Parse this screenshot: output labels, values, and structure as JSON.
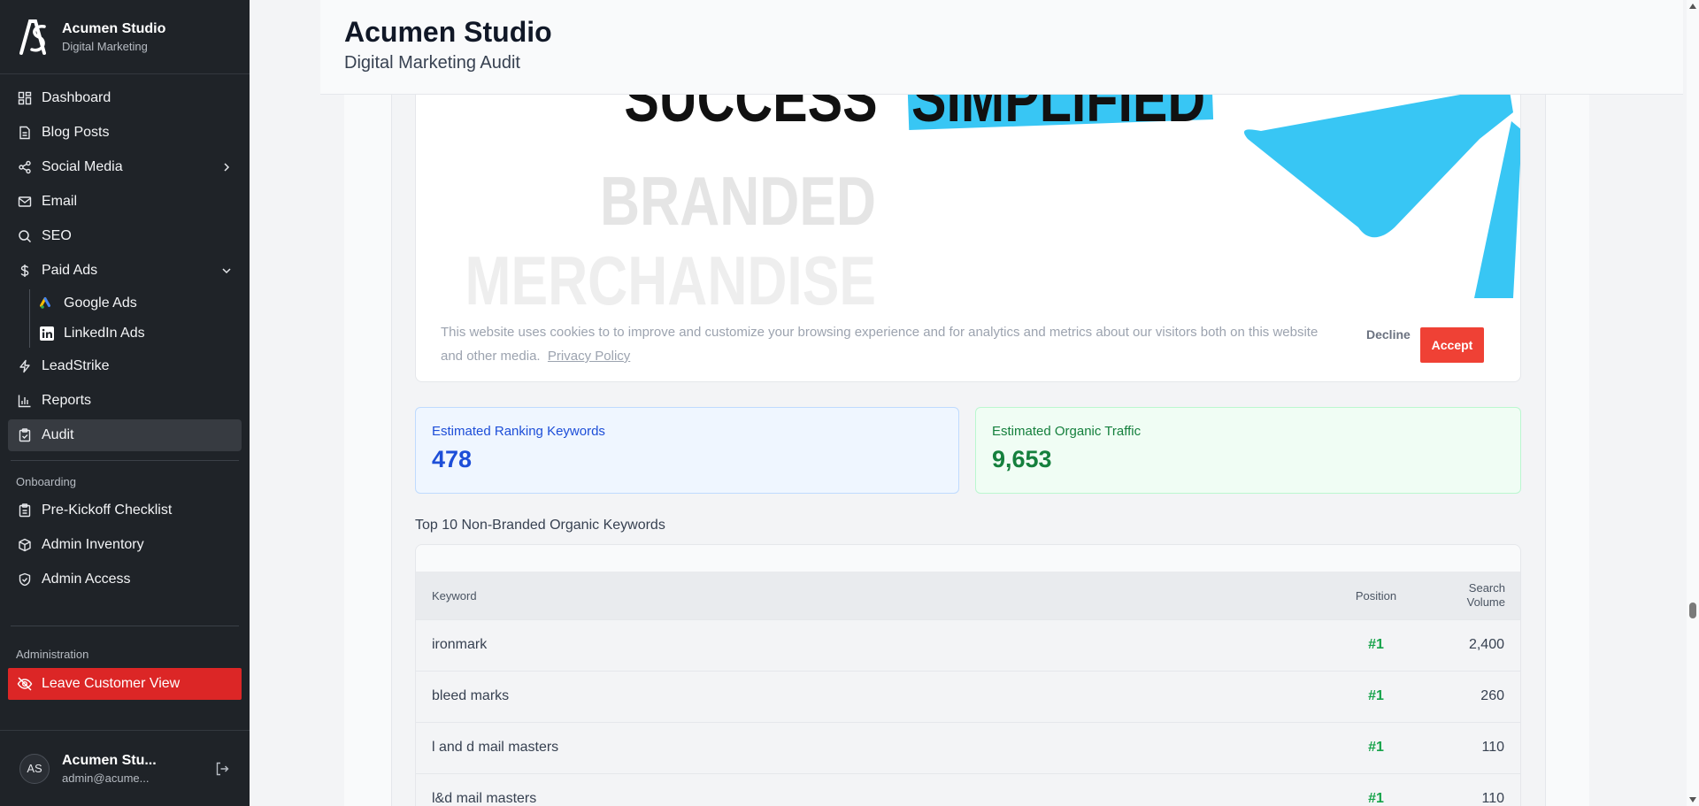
{
  "brand": {
    "title": "Acumen Studio",
    "subtitle": "Digital Marketing"
  },
  "nav": {
    "items": [
      {
        "label": "Dashboard",
        "icon": "dashboard-icon"
      },
      {
        "label": "Blog Posts",
        "icon": "document-icon"
      },
      {
        "label": "Social Media",
        "icon": "share-icon"
      },
      {
        "label": "Email",
        "icon": "mail-icon"
      },
      {
        "label": "SEO",
        "icon": "search-icon"
      },
      {
        "label": "Paid Ads",
        "icon": "dollar-icon"
      }
    ],
    "paid_ads_sub": [
      {
        "label": "Google Ads",
        "icon": "google-ads-icon"
      },
      {
        "label": "LinkedIn Ads",
        "icon": "linkedin-icon"
      }
    ],
    "items2": [
      {
        "label": "LeadStrike",
        "icon": "bolt-icon"
      },
      {
        "label": "Reports",
        "icon": "bar-chart-icon"
      },
      {
        "label": "Audit",
        "icon": "clipboard-check-icon"
      }
    ],
    "onboarding_label": "Onboarding",
    "onboarding": [
      {
        "label": "Pre-Kickoff Checklist",
        "icon": "clipboard-icon"
      },
      {
        "label": "Admin Inventory",
        "icon": "box-icon"
      },
      {
        "label": "Admin Access",
        "icon": "shield-check-icon"
      }
    ],
    "administration_label": "Administration",
    "leave_label": "Leave Customer View"
  },
  "user": {
    "initials": "AS",
    "name": "Acumen Stu...",
    "email": "admin@acume..."
  },
  "header": {
    "title": "Acumen Studio",
    "subtitle": "Digital Marketing Audit"
  },
  "banner": {
    "headline_left": "SUCCESS",
    "headline_right": "SIMPLIFIED",
    "line1": "BRANDED",
    "line2": "MERCHANDISE"
  },
  "cookie": {
    "text": "This website uses cookies to to improve and customize your browsing experience and for analytics and metrics about our visitors both on this website and other media.",
    "link": "Privacy Policy",
    "decline": "Decline",
    "accept": "Accept"
  },
  "stats": {
    "ranking_label": "Estimated Ranking Keywords",
    "ranking_value": "478",
    "traffic_label": "Estimated Organic Traffic",
    "traffic_value": "9,653"
  },
  "table": {
    "title": "Top 10 Non-Branded Organic Keywords",
    "headers": {
      "keyword": "Keyword",
      "position": "Position",
      "volume_line1": "Search",
      "volume_line2": "Volume"
    },
    "rows": [
      {
        "keyword": "ironmark",
        "position": "#1",
        "volume": "2,400"
      },
      {
        "keyword": "bleed marks",
        "position": "#1",
        "volume": "260"
      },
      {
        "keyword": "l and d mail masters",
        "position": "#1",
        "volume": "110"
      },
      {
        "keyword": "l&d mail masters",
        "position": "#1",
        "volume": "110"
      }
    ]
  },
  "colors": {
    "sidebar_bg": "#1f2328",
    "accent_red": "#dc2626",
    "accept_red": "#ef4135",
    "banner_blue": "#38c6f4",
    "blue_text": "#1d4ed8",
    "green_text": "#15803d"
  }
}
